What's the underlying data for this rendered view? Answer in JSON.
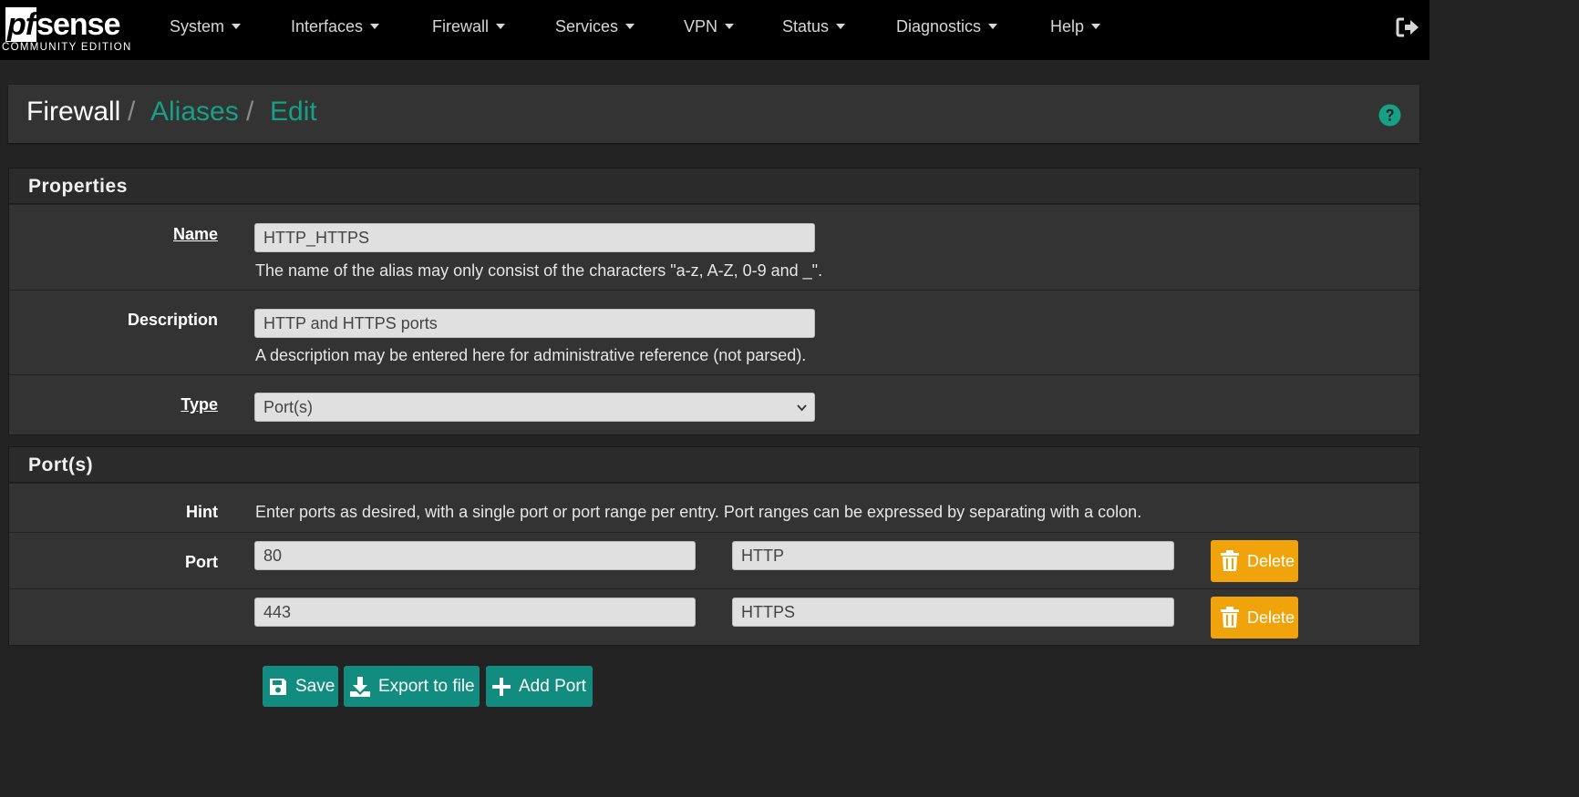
{
  "brand": {
    "logo_pf": "pf",
    "logo_sense": "sense",
    "edition": "COMMUNITY EDITION"
  },
  "nav": {
    "items": [
      "System",
      "Interfaces",
      "Firewall",
      "Services",
      "VPN",
      "Status",
      "Diagnostics",
      "Help"
    ],
    "logout_icon": "sign-out-icon"
  },
  "breadcrumb": {
    "root": "Firewall",
    "sep": "/",
    "aliases": "Aliases",
    "edit": "Edit"
  },
  "properties": {
    "title": "Properties",
    "name_label": "Name",
    "name_value": "HTTP_HTTPS",
    "name_help": "The name of the alias may only consist of the characters \"a-z, A-Z, 0-9 and _\".",
    "description_label": "Description",
    "description_value": "HTTP and HTTPS ports",
    "description_help": "A description may be entered here for administrative reference (not parsed).",
    "type_label": "Type",
    "type_value": "Port(s)"
  },
  "ports": {
    "title": "Port(s)",
    "hint_label": "Hint",
    "hint_text": "Enter ports as desired, with a single port or port range per entry. Port ranges can be expressed by separating with a colon.",
    "port_label": "Port",
    "rows": [
      {
        "port": "80",
        "description": "HTTP",
        "delete_label": "Delete"
      },
      {
        "port": "443",
        "description": "HTTPS",
        "delete_label": "Delete"
      }
    ]
  },
  "actions": {
    "save": "Save",
    "export": "Export to file",
    "add_port": "Add Port"
  },
  "colors": {
    "accent": "#16a085",
    "button": "#128c7e",
    "delete": "#f0a30a",
    "navbar": "#000000"
  }
}
